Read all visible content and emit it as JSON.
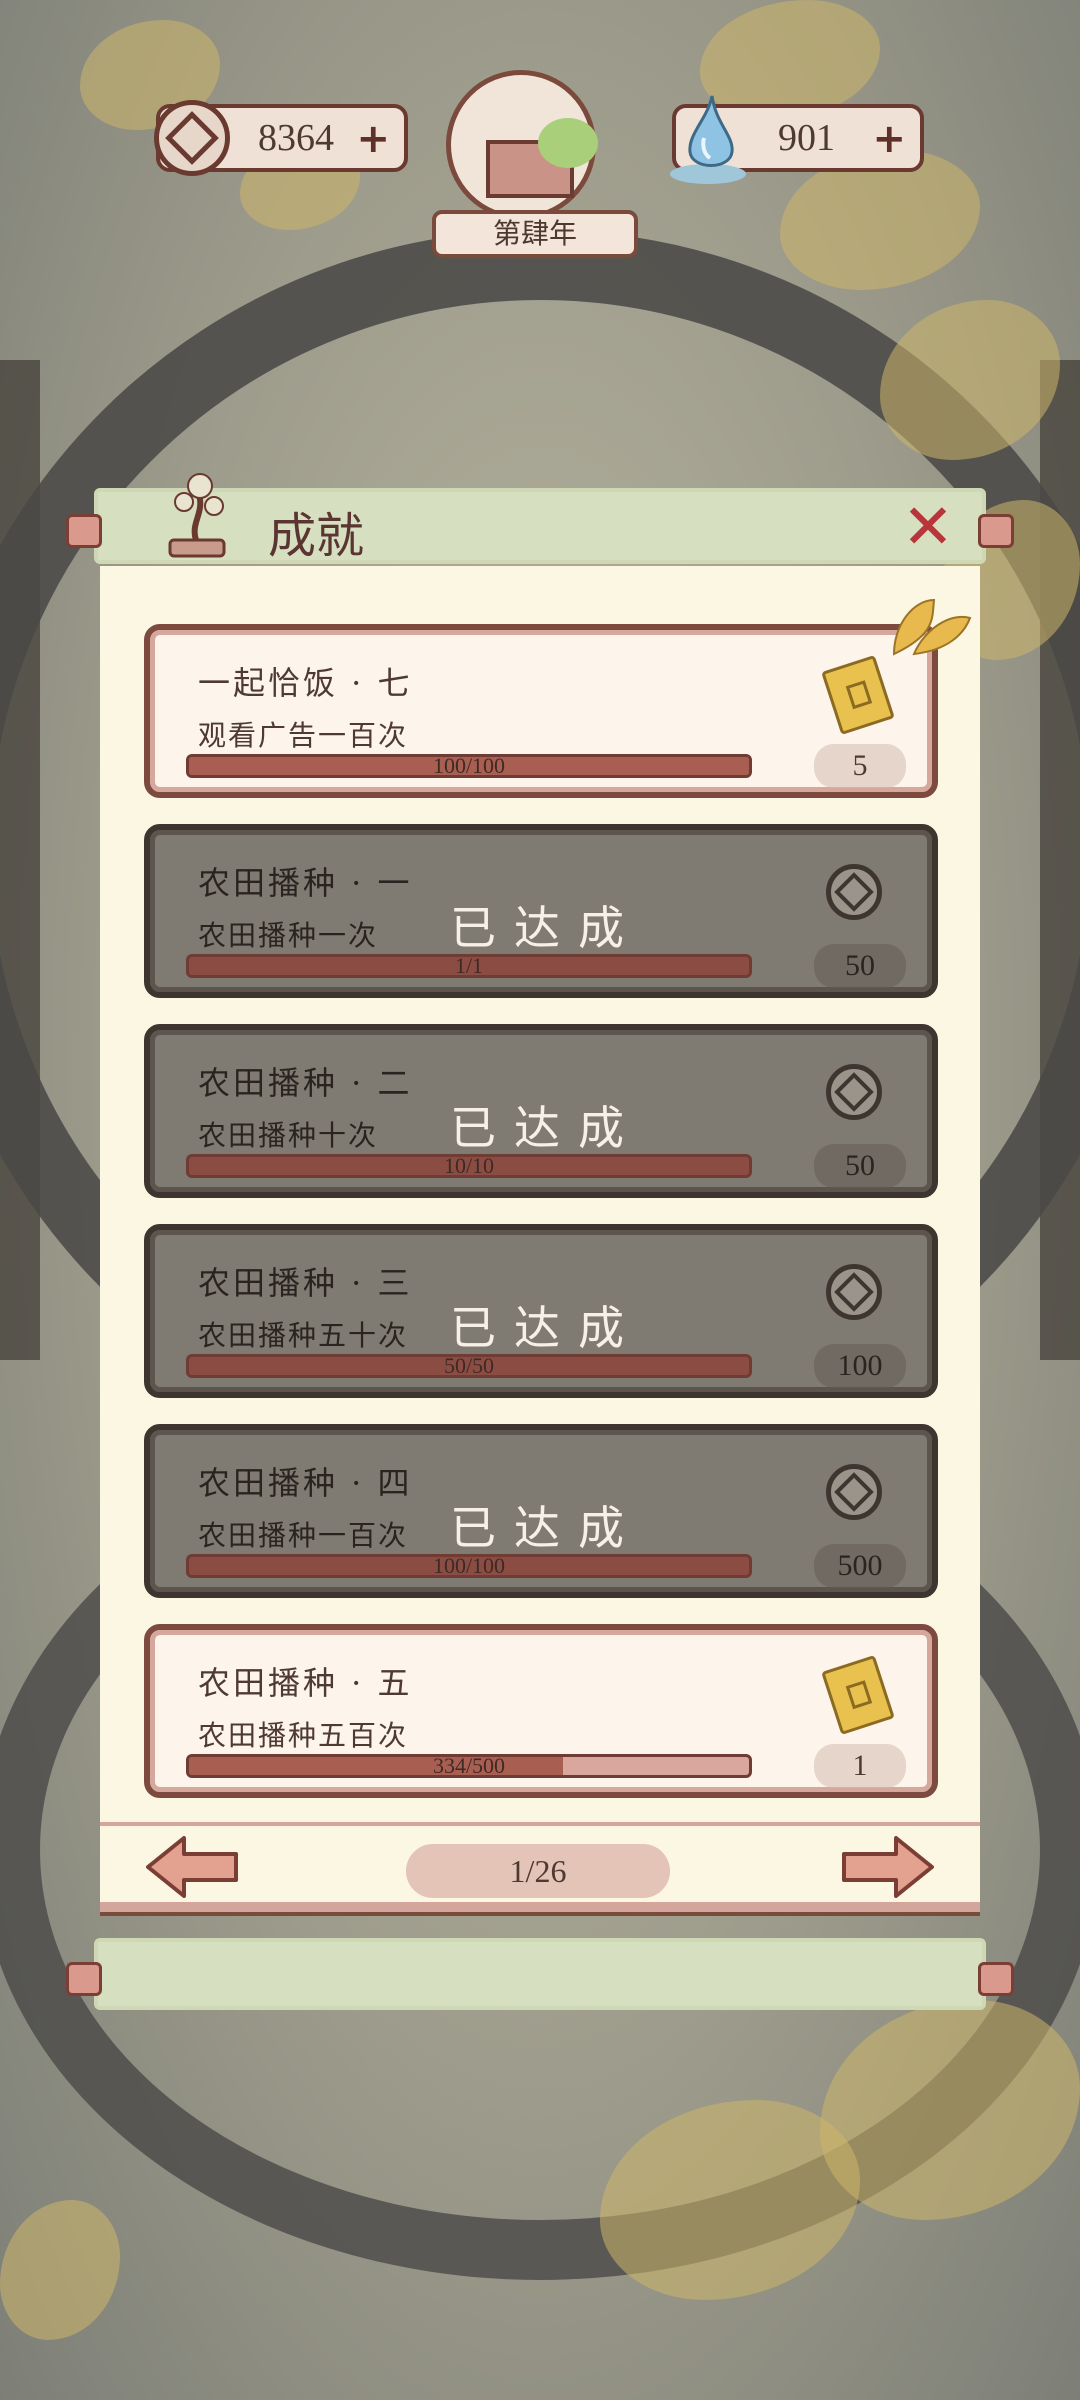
{
  "hud": {
    "copper_coins": "8364",
    "spirit_water": "901",
    "year": "第肆年"
  },
  "panel": {
    "title": "成就",
    "done_stamp": "已达成"
  },
  "achievements": [
    {
      "name": "一起恰饭 · 七",
      "desc": "观看广告一百次",
      "progress_text": "100/100",
      "progress": 1.0,
      "reward": "5",
      "reward_icon": "ticket-icon",
      "done": false
    },
    {
      "name": "农田播种 · 一",
      "desc": "农田播种一次",
      "progress_text": "1/1",
      "progress": 1.0,
      "reward": "50",
      "reward_icon": "coin-icon",
      "done": true
    },
    {
      "name": "农田播种 · 二",
      "desc": "农田播种十次",
      "progress_text": "10/10",
      "progress": 1.0,
      "reward": "50",
      "reward_icon": "coin-icon",
      "done": true
    },
    {
      "name": "农田播种 · 三",
      "desc": "农田播种五十次",
      "progress_text": "50/50",
      "progress": 1.0,
      "reward": "100",
      "reward_icon": "coin-icon",
      "done": true
    },
    {
      "name": "农田播种 · 四",
      "desc": "农田播种一百次",
      "progress_text": "100/100",
      "progress": 1.0,
      "reward": "500",
      "reward_icon": "coin-icon",
      "done": true
    },
    {
      "name": "农田播种 · 五",
      "desc": "农田播种五百次",
      "progress_text": "334/500",
      "progress": 0.668,
      "reward": "1",
      "reward_icon": "ticket-icon",
      "done": false
    }
  ],
  "pager": {
    "page": "1/26"
  },
  "colors": {
    "accent": "#6a3a31",
    "close": "#b7353b",
    "panel_bg": "#fcf7e3",
    "header_bg": "#d6e0c0"
  }
}
